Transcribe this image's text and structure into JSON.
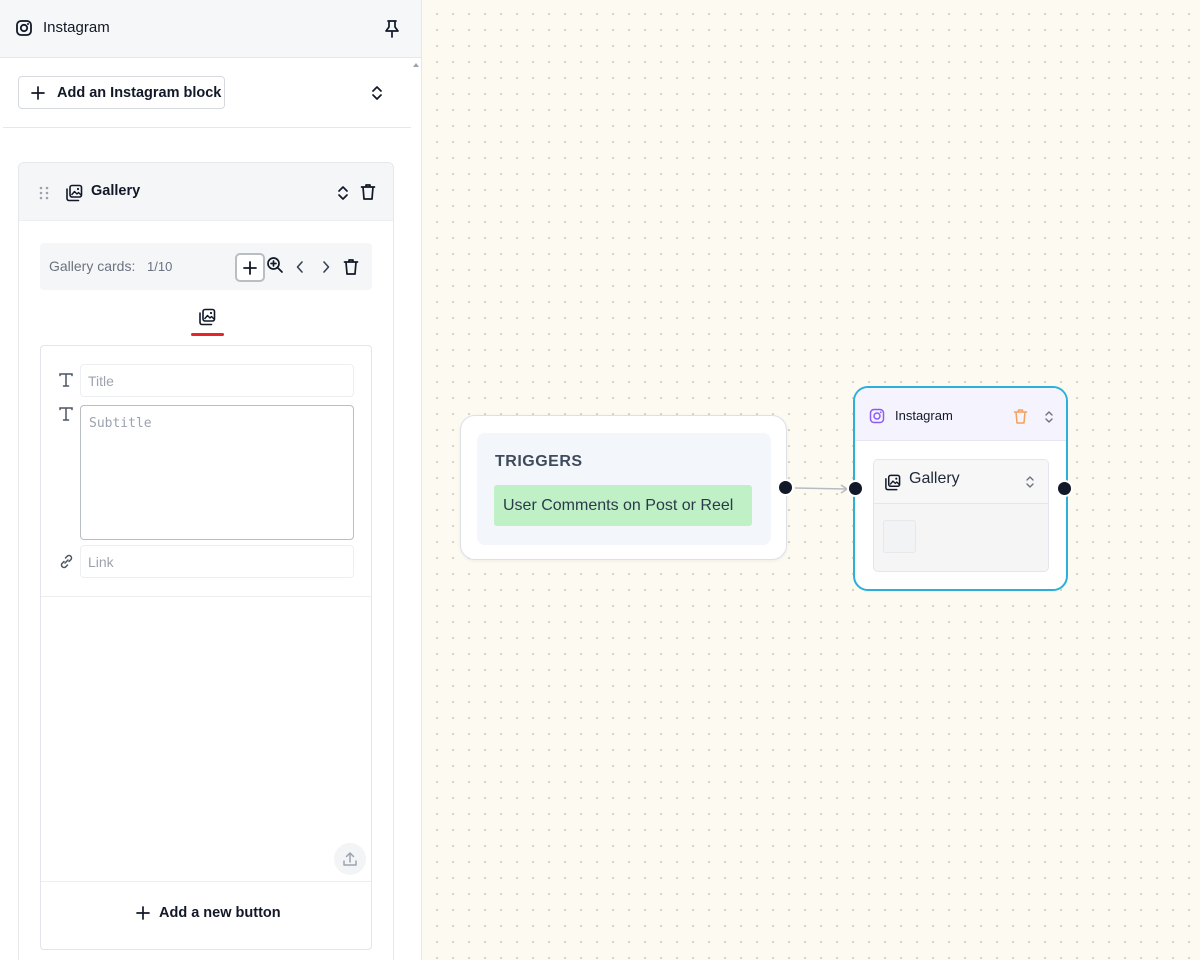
{
  "panel": {
    "title": "Instagram",
    "add_block_label": "Add an Instagram block",
    "block": {
      "title": "Gallery",
      "cards_label": "Gallery cards:",
      "cards_count": "1/10",
      "fields": {
        "title_placeholder": "Title",
        "subtitle_placeholder": "Subtitle",
        "link_placeholder": "Link"
      },
      "add_button_label": "Add a new button"
    }
  },
  "canvas": {
    "trigger_node": {
      "title": "TRIGGERS",
      "chip": "User Comments on Post or Reel"
    },
    "instagram_node": {
      "title": "Instagram",
      "block_title": "Gallery"
    }
  },
  "colors": {
    "active_tab": "#e5252a",
    "selected_node_border": "#2cb0d9",
    "trigger_chip": "#bff0c6",
    "delete_icon_node": "#f3a15c"
  },
  "icons": [
    "instagram-icon",
    "pin-icon",
    "plus-icon",
    "chevron-updown-icon",
    "drag-handle-icon",
    "gallery-icon",
    "trash-icon",
    "zoom-in-icon",
    "chevron-left-icon",
    "chevron-right-icon",
    "text-icon",
    "link-icon",
    "upload-icon"
  ]
}
